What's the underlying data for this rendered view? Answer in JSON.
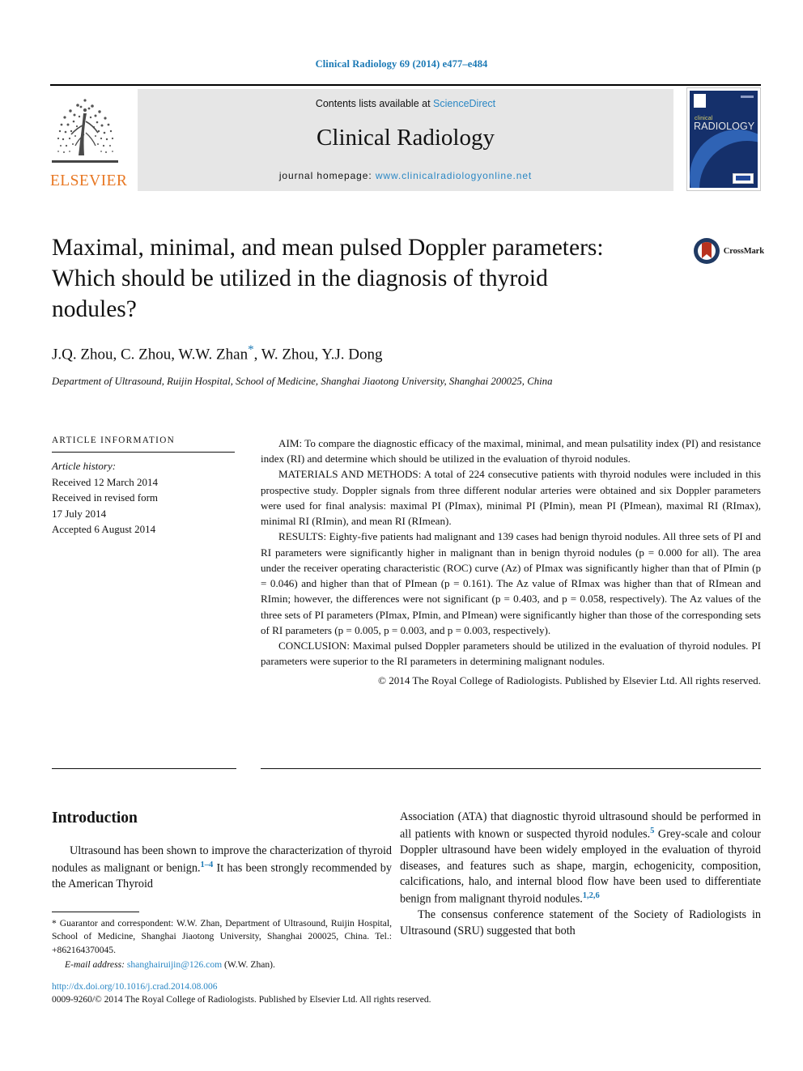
{
  "running_head": "Clinical Radiology 69 (2014) e477–e484",
  "masthead": {
    "publisher_logo_label": "ELSEVIER",
    "contents_prefix": "Contents lists available at",
    "contents_link": "ScienceDirect",
    "journal_name": "Clinical Radiology",
    "homepage_prefix": "journal homepage:",
    "homepage_url": "www.clinicalradiologyonline.net",
    "cover": {
      "title_small": "clinical",
      "title_large": "RADIOLOGY"
    }
  },
  "article": {
    "title": "Maximal, minimal, and mean pulsed Doppler parameters: Which should be utilized in the diagnosis of thyroid nodules?",
    "authors": "J.Q. Zhou, C. Zhou, W.W. Zhan",
    "authors_tail": ", W. Zhou, Y.J. Dong",
    "author_star": "*",
    "affiliation": "Department of Ultrasound, Ruijin Hospital, School of Medicine, Shanghai Jiaotong University, Shanghai 200025, China",
    "crossmark_label": "CrossMark"
  },
  "article_information": {
    "heading": "ARTICLE INFORMATION",
    "history_label": "Article history:",
    "history": [
      "Received 12 March 2014",
      "Received in revised form",
      "17 July 2014",
      "Accepted 6 August 2014"
    ]
  },
  "abstract": {
    "aim": "AIM: To compare the diagnostic efficacy of the maximal, minimal, and mean pulsatility index (PI) and resistance index (RI) and determine which should be utilized in the evaluation of thyroid nodules.",
    "materials": "MATERIALS AND METHODS: A total of 224 consecutive patients with thyroid nodules were included in this prospective study. Doppler signals from three different nodular arteries were obtained and six Doppler parameters were used for final analysis: maximal PI (PImax), minimal PI (PImin), mean PI (PImean), maximal RI (RImax), minimal RI (RImin), and mean RI (RImean).",
    "results": "RESULTS: Eighty-five patients had malignant and 139 cases had benign thyroid nodules. All three sets of PI and RI parameters were significantly higher in malignant than in benign thyroid nodules (p = 0.000 for all). The area under the receiver operating characteristic (ROC) curve (Az) of PImax was significantly higher than that of PImin (p = 0.046) and higher than that of PImean (p = 0.161). The Az value of RImax was higher than that of RImean and RImin; however, the differences were not significant (p = 0.403, and p = 0.058, respectively). The Az values of the three sets of PI parameters (PImax, PImin, and PImean) were significantly higher than those of the corresponding sets of RI parameters (p = 0.005, p = 0.003, and p = 0.003, respectively).",
    "conclusion": "CONCLUSION: Maximal pulsed Doppler parameters should be utilized in the evaluation of thyroid nodules. PI parameters were superior to the RI parameters in determining malignant nodules.",
    "copyright": "© 2014 The Royal College of Radiologists. Published by Elsevier Ltd. All rights reserved."
  },
  "body": {
    "introduction_heading": "Introduction",
    "left_paragraph_1_a": "Ultrasound has been shown to improve the characterization of thyroid nodules as malignant or benign.",
    "left_paragraph_1_ref": "1–4",
    "left_paragraph_1_b": " It has been strongly recommended by the American Thyroid",
    "right_paragraph_1_a": "Association (ATA) that diagnostic thyroid ultrasound should be performed in all patients with known or suspected thyroid nodules.",
    "right_paragraph_1_ref": "5",
    "right_paragraph_1_b": " Grey-scale and colour Doppler ultrasound have been widely employed in the evaluation of thyroid diseases, and features such as shape, margin, echogenicity, composition, calcifications, halo, and internal blood flow have been used to differentiate benign from malignant thyroid nodules.",
    "right_paragraph_1_ref2": "1,2,6",
    "right_paragraph_2": "The consensus conference statement of the Society of Radiologists in Ultrasound (SRU) suggested that both"
  },
  "footnote": {
    "correspondence": "* Guarantor and correspondent: W.W. Zhan, Department of Ultrasound, Ruijin Hospital, School of Medicine, Shanghai Jiaotong University, Shanghai 200025, China. Tel.: +862164370045.",
    "email_label": "E-mail address:",
    "email": "shanghairuijin@126.com",
    "email_owner": "(W.W. Zhan)."
  },
  "footer": {
    "doi": "http://dx.doi.org/10.1016/j.crad.2014.08.006",
    "issn_line": "0009-9260/© 2014 The Royal College of Radiologists. Published by Elsevier Ltd. All rights reserved."
  },
  "colors": {
    "link_blue": "#2a87c4",
    "heading_blue": "#1b79b5",
    "elsevier_orange": "#e87722",
    "band_grey": "#e6e6e6",
    "cover_navy": "#15306b",
    "crossmark_red": "#b8321e"
  }
}
